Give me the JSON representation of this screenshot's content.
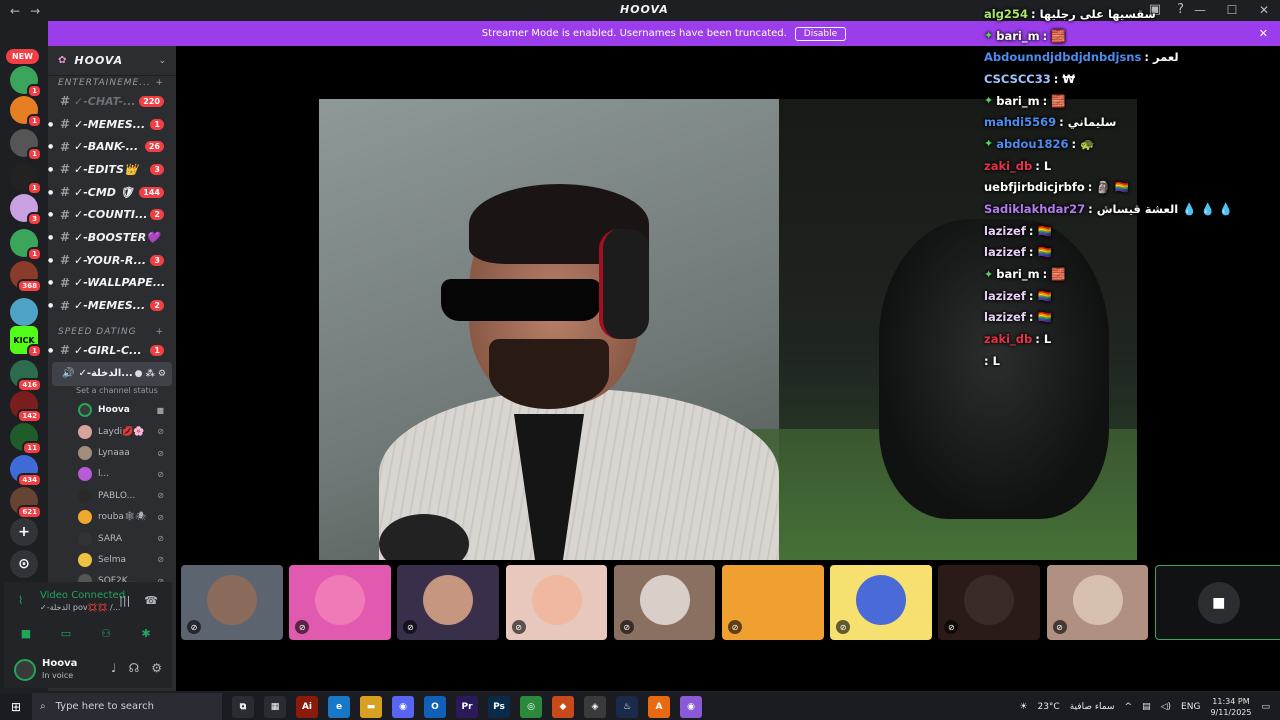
{
  "titlebar": {
    "back": "←",
    "forward": "→",
    "app_name": "HOOVA",
    "min": "—",
    "max": "☐",
    "close": "✕"
  },
  "banner": {
    "text": "Streamer Mode is enabled. Usernames have been truncated.",
    "button": "Disable"
  },
  "rail": {
    "new_label": "NEW",
    "servers": [
      {
        "badge": "1",
        "color": "#3ba55c"
      },
      {
        "badge": "1",
        "color": "#e67e22"
      },
      {
        "badge": "1",
        "color": "#555"
      },
      {
        "badge": "1",
        "color": "#222"
      },
      {
        "badge": "3",
        "color": "#c9a0e0"
      },
      {
        "badge": "1",
        "color": "#3ba55c"
      },
      {
        "badge": "368",
        "color": "#8a3b2a"
      },
      {
        "badge": "",
        "color": "#4fa3c7"
      },
      {
        "badge": "1",
        "color": "#53fc18"
      },
      {
        "badge": "416",
        "color": "#2d6b4e"
      },
      {
        "badge": "142",
        "color": "#7a1d1d"
      },
      {
        "badge": "11",
        "color": "#1f5c2a"
      },
      {
        "badge": "434",
        "color": "#3f6bd8"
      },
      {
        "badge": "621",
        "color": "#664433"
      }
    ],
    "kick_label": "KICK",
    "add": "+",
    "explore": "⊙"
  },
  "sidebar": {
    "server_name": "HOOVA",
    "category_1": "ENTERTAINEME...",
    "channels_top": [
      {
        "name": "✓-CHAT-...",
        "badge": "220"
      },
      {
        "name": "✓-MEMES...",
        "badge": "1"
      },
      {
        "name": "✓-BANK-...",
        "badge": "26"
      },
      {
        "name": "✓-EDITS👑",
        "badge": "3"
      },
      {
        "name": "✓-CMD 🛡",
        "badge": "144"
      },
      {
        "name": "✓-COUNTI...",
        "badge": "2"
      },
      {
        "name": "✓-BOOSTER💜",
        "badge": ""
      },
      {
        "name": "✓-YOUR-R...",
        "badge": "3"
      },
      {
        "name": "✓-WALLPAPE...",
        "badge": ""
      },
      {
        "name": "✓-MEMES...",
        "badge": "2"
      }
    ],
    "category_2": "SPEED DATING",
    "channel_girl": {
      "name": "✓-GIRL-C...",
      "badge": "1"
    },
    "voice_channel": "✓-الدخلة...",
    "channel_status": "Set a channel status",
    "voice_users": [
      {
        "name": "Hoova",
        "color": "#3a3a3a"
      },
      {
        "name": "Laydi💋🌸",
        "color": "#d7a39a"
      },
      {
        "name": "Lynaaa",
        "color": "#a08d7a"
      },
      {
        "name": "l...",
        "color": "#b95ad6"
      },
      {
        "name": "PABLO...",
        "color": "#2a2a2a"
      },
      {
        "name": "rouba🕸🕷",
        "color": "#f0a830"
      },
      {
        "name": "SARA",
        "color": "#333"
      },
      {
        "name": "Selma",
        "color": "#f0c040"
      },
      {
        "name": "SOF2K...",
        "color": "#555"
      }
    ]
  },
  "voice_panel": {
    "status": "Video Connected",
    "sub": "✓-الدخلة pov💢💢 /..."
  },
  "user": {
    "name": "Hoova",
    "status": "In voice"
  },
  "chat": [
    {
      "user": "alg254",
      "ucolor": "#a8e46d",
      "text": "سقسيها على رجليها",
      "star": false
    },
    {
      "user": "bari_m",
      "ucolor": "#ffffff",
      "text": "🧱",
      "star": true
    },
    {
      "user": "Abdounndjdbdjdnbdjsns",
      "ucolor": "#4e8cf0",
      "text": "لعمر",
      "star": false
    },
    {
      "user": "CSCSCC33",
      "ucolor": "#9ec5ff",
      "text": "₩",
      "star": false
    },
    {
      "user": "bari_m",
      "ucolor": "#ffffff",
      "text": "🧱",
      "star": true
    },
    {
      "user": "mahdi5569",
      "ucolor": "#4e8cf0",
      "text": "سليماني",
      "star": false
    },
    {
      "user": "abdou1826",
      "ucolor": "#4e8cf0",
      "text": "🐢",
      "star": true
    },
    {
      "user": "zaki_db",
      "ucolor": "#e8304a",
      "text": "L",
      "star": false
    },
    {
      "user": "uebfjirbdicjrbfo",
      "ucolor": "#ffffff",
      "text": "🗿 🏳️‍🌈",
      "star": false
    },
    {
      "user": "Sadiklakhdar27",
      "ucolor": "#b47bf0",
      "text": "العشة قيساش 💧 💧 💧",
      "star": false
    },
    {
      "user": "lazizef",
      "ucolor": "#e8d0f8",
      "text": "🏳️‍🌈",
      "star": false
    },
    {
      "user": "lazizef",
      "ucolor": "#e8d0f8",
      "text": "🏳️‍🌈",
      "star": false
    },
    {
      "user": "bari_m",
      "ucolor": "#ffffff",
      "text": "🧱",
      "star": true
    },
    {
      "user": "lazizef",
      "ucolor": "#e8d0f8",
      "text": "🏳️‍🌈",
      "star": false
    },
    {
      "user": "lazizef",
      "ucolor": "#e8d0f8",
      "text": "🏳️‍🌈",
      "star": false
    },
    {
      "user": "zaki_db",
      "ucolor": "#e8304a",
      "text": "L",
      "star": false
    },
    {
      "user": "",
      "ucolor": "#ffffff",
      "text": "L",
      "star": false
    }
  ],
  "tiles": [
    {
      "bg": "#5c6470",
      "face": "#8a6a5a"
    },
    {
      "bg": "#e05ab0",
      "face": "#f07ab8"
    },
    {
      "bg": "#3a2f4a",
      "face": "#c79680"
    },
    {
      "bg": "#e8c8bc",
      "face": "#f0b8a0"
    },
    {
      "bg": "#8a7060",
      "face": "#d8d0c8"
    },
    {
      "bg": "#f0a030",
      "face": "#f0a030"
    },
    {
      "bg": "#f5e070",
      "face": "#4a6ad8"
    },
    {
      "bg": "#2a1a18",
      "face": "#3a2a28"
    },
    {
      "bg": "#b09080",
      "face": "#d8c0b0"
    }
  ],
  "taskbar": {
    "search_placeholder": "Type here to search",
    "weather": "23°C",
    "weather_desc": "سماء صافية",
    "lang": "ENG",
    "time": "11:34 PM",
    "date": "9/11/2025",
    "apps": [
      {
        "label": "⧉",
        "color": "#2b2c33"
      },
      {
        "label": "▦",
        "color": "#2b2c33"
      },
      {
        "label": "Ai",
        "color": "#8a1a0a"
      },
      {
        "label": "e",
        "color": "#1878c8"
      },
      {
        "label": "▬",
        "color": "#d8a020"
      },
      {
        "label": "◉",
        "color": "#5865f2"
      },
      {
        "label": "O",
        "color": "#1060b8"
      },
      {
        "label": "Pr",
        "color": "#2a1a5a"
      },
      {
        "label": "Ps",
        "color": "#0a2a4a"
      },
      {
        "label": "◎",
        "color": "#2a8a3a"
      },
      {
        "label": "◆",
        "color": "#c84a1a"
      },
      {
        "label": "◈",
        "color": "#3a3a3a"
      },
      {
        "label": "♨",
        "color": "#1a2a4a"
      },
      {
        "label": "A",
        "color": "#e86a10"
      },
      {
        "label": "◉",
        "color": "#8a5ad8"
      }
    ]
  }
}
